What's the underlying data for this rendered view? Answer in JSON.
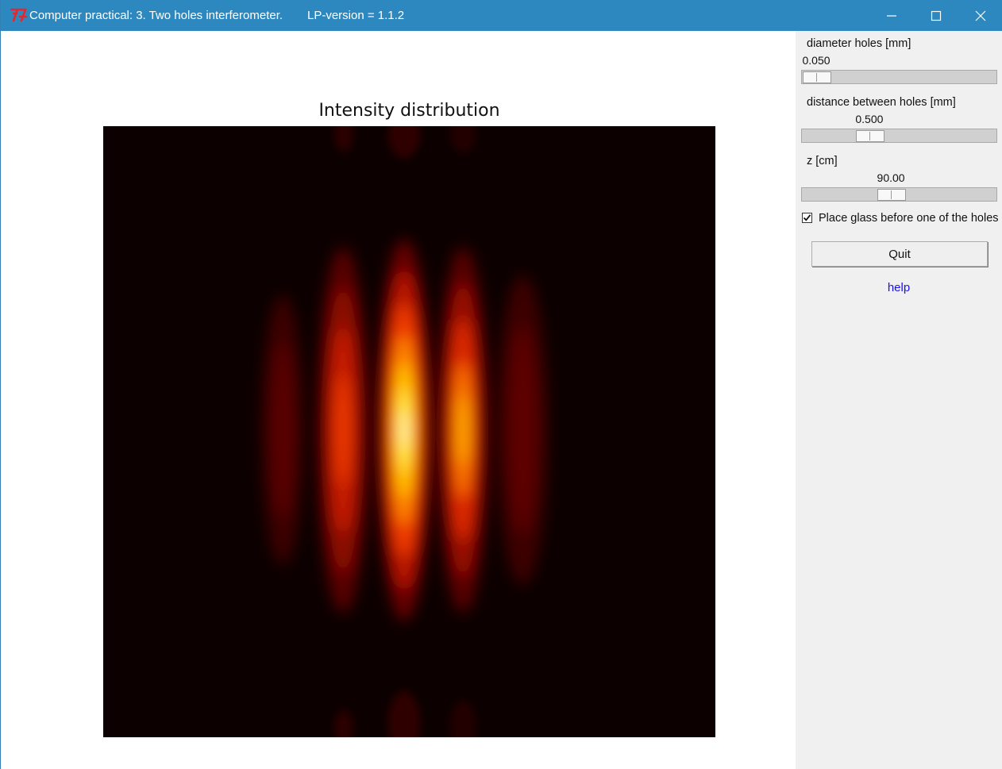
{
  "window": {
    "title": "Computer practical: 3. Two holes interferometer.",
    "version": "LP-version = 1.1.2",
    "icon": "tk-feather-icon",
    "accent": "#2e88c0"
  },
  "plot": {
    "title": "Intensity distribution",
    "colormap": "hot"
  },
  "controls": {
    "diameter": {
      "label": "diameter holes [mm]",
      "value": "0.050",
      "fraction": 0.0
    },
    "distance": {
      "label": "distance between holes [mm]",
      "value": "0.500",
      "fraction": 0.32
    },
    "z": {
      "label": "z [cm]",
      "value": "90.00",
      "fraction": 0.45
    },
    "glass": {
      "label": "Place glass before one of the holes",
      "checked": true
    },
    "quit_label": "Quit",
    "help_label": "help"
  }
}
